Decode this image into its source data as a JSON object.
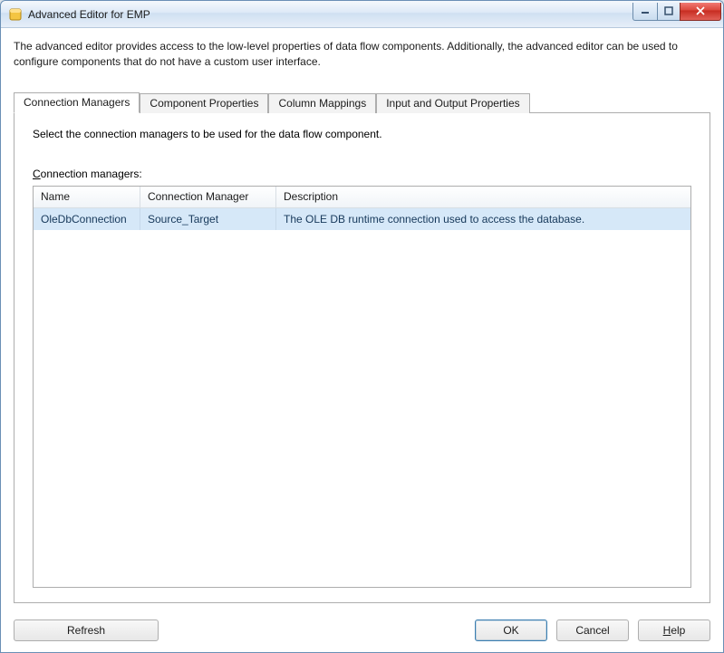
{
  "window": {
    "title": "Advanced Editor for EMP"
  },
  "intro": "The advanced editor provides access to the low-level properties of data flow components. Additionally, the advanced editor can be used to configure components that do not have a custom user interface.",
  "tabs": {
    "t0": "Connection Managers",
    "t1": "Component Properties",
    "t2": "Column Mappings",
    "t3": "Input and Output Properties"
  },
  "panel": {
    "instr": "Select the connection managers to be used for the data flow component.",
    "cm_label_pre": "C",
    "cm_label_rest": "onnection managers:",
    "headers": {
      "name": "Name",
      "cm": "Connection Manager",
      "desc": "Description"
    },
    "rows": [
      {
        "name": "OleDbConnection",
        "cm": "Source_Target",
        "desc": "The OLE DB runtime connection used to access the database."
      }
    ]
  },
  "buttons": {
    "refresh": "Refresh",
    "ok": "OK",
    "cancel": "Cancel",
    "help_pre": "H",
    "help_rest": "elp"
  }
}
